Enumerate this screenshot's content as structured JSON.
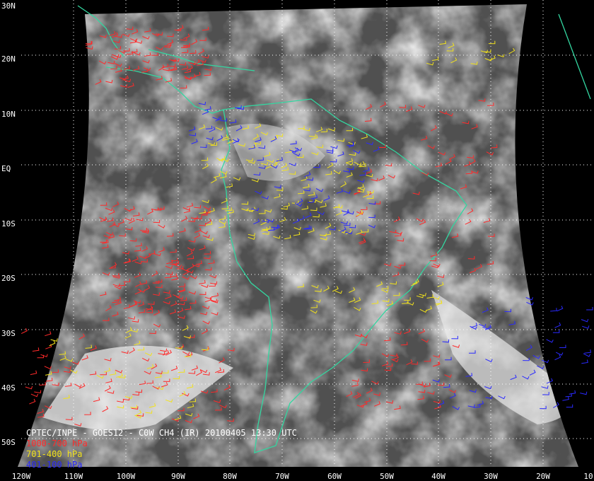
{
  "title": "CPTEC/INPE - GOES12 - C0W CH4 (IR) 20100405 13:30 UTC",
  "legend": [
    {
      "label": "1000-700 hPa",
      "color": "#ff2a2a"
    },
    {
      "label": "701-400 hPa",
      "color": "#f2e21c"
    },
    {
      "label": "401-100 hPa",
      "color": "#2a2aff"
    }
  ],
  "latitude_labels": [
    "30N",
    "20N",
    "10N",
    "EQ",
    "10S",
    "20S",
    "30S",
    "40S",
    "50S"
  ],
  "longitude_labels": [
    "120W",
    "110W",
    "100W",
    "90W",
    "80W",
    "70W",
    "60W",
    "50W",
    "40W",
    "30W",
    "20W",
    "10"
  ],
  "colors": {
    "coastline": "#33d6a0",
    "grid": "#ffffff",
    "background": "#000000"
  }
}
